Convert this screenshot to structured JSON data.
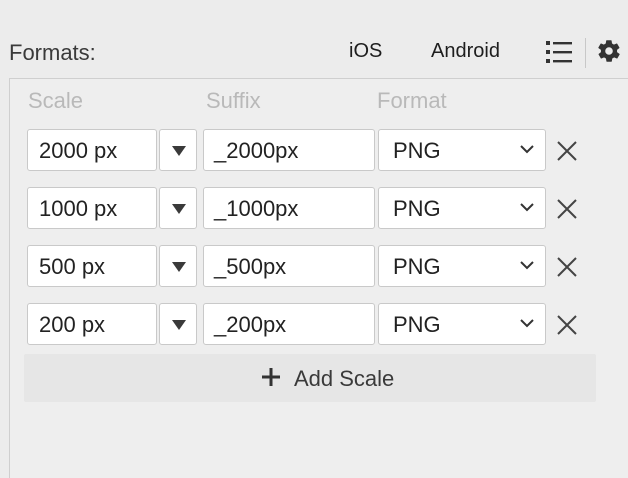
{
  "header": {
    "title": "Formats:",
    "presets": [
      "iOS",
      "Android"
    ],
    "list_icon": "list-icon",
    "settings_icon": "gear-icon"
  },
  "columns": {
    "scale": "Scale",
    "suffix": "Suffix",
    "format": "Format"
  },
  "rows": [
    {
      "scale": "2000 px",
      "suffix": "_2000px",
      "format": "PNG"
    },
    {
      "scale": "1000 px",
      "suffix": "_1000px",
      "format": "PNG"
    },
    {
      "scale": "500 px",
      "suffix": "_500px",
      "format": "PNG"
    },
    {
      "scale": "200 px",
      "suffix": "_200px",
      "format": "PNG"
    }
  ],
  "add_scale": {
    "label": "Add Scale",
    "icon": "plus-icon"
  },
  "colors": {
    "background": "#ececec",
    "field_bg": "#ffffff",
    "header_muted": "#b9b9b9"
  }
}
